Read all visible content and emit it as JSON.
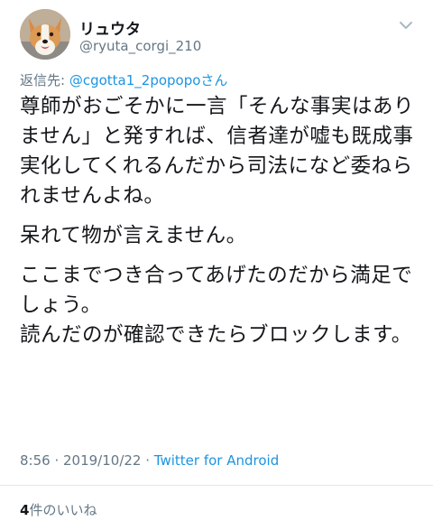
{
  "user": {
    "display_name": "リュウタ",
    "handle": "@ryuta_corgi_210",
    "avatar_icon": "corgi-avatar-icon"
  },
  "reply": {
    "prefix": "返信先: ",
    "to_user": "@cgotta1_2popopo",
    "suffix": "さん"
  },
  "tweet": {
    "paragraph1": "尊師がおごそかに一言「そんな事実はありません」と発すれば、信者達が嘘も既成事実化してくれるんだから司法になど委ねられませんよね。",
    "paragraph2": "呆れて物が言えません。",
    "paragraph3_line1": "ここまでつき合ってあげたのだから満足でしょう。",
    "paragraph3_line2": "読んだのが確認できたらブロックします。"
  },
  "meta": {
    "time": "8:56",
    "separator": " · ",
    "date": "2019/10/22",
    "source": "Twitter for Android"
  },
  "likes": {
    "count": "4",
    "label": "件のいいね"
  },
  "colors": {
    "link": "#1b95e0",
    "secondary_text": "#657786",
    "primary_text": "#14171a"
  }
}
